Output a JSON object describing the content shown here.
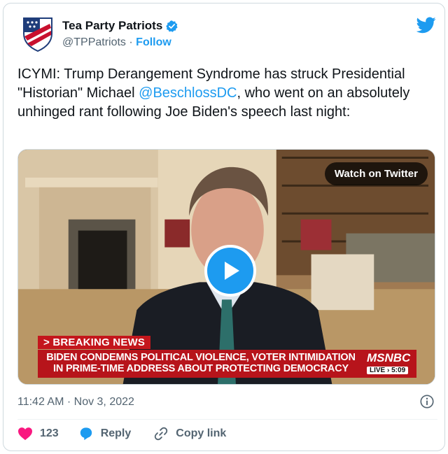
{
  "author": {
    "display_name": "Tea Party Patriots",
    "handle": "@TPPatriots",
    "separator": "·",
    "follow_label": "Follow"
  },
  "tweet": {
    "text_before": "ICYMI: Trump Derangement Syndrome has struck Presidential \"Historian\" Michael ",
    "mention": "@BeschlossDC",
    "text_after": ", who went on an absolutely unhinged rant following Joe Biden's speech last night:"
  },
  "media": {
    "watch_label": "Watch on Twitter",
    "breaking_tag": "> BREAKING NEWS",
    "headline_line1": "BIDEN CONDEMNS POLITICAL VIOLENCE, VOTER INTIMIDATION",
    "headline_line2": "IN PRIME-TIME ADDRESS ABOUT PROTECTING DEMOCRACY",
    "network": "MSNBC",
    "live_label": "LIVE",
    "live_time": "5:09"
  },
  "footer": {
    "timestamp": "11:42 AM · Nov 3, 2022",
    "like_count": "123",
    "reply_label": "Reply",
    "copy_label": "Copy link"
  },
  "colors": {
    "accent": "#1d9bf0",
    "like": "#f91880",
    "breaking_red": "#b7141b"
  },
  "icons": [
    "shield-flag-logo",
    "verified-badge-icon",
    "twitter-bird-icon",
    "play-icon",
    "info-icon",
    "heart-icon",
    "reply-bubble-icon",
    "link-icon"
  ]
}
